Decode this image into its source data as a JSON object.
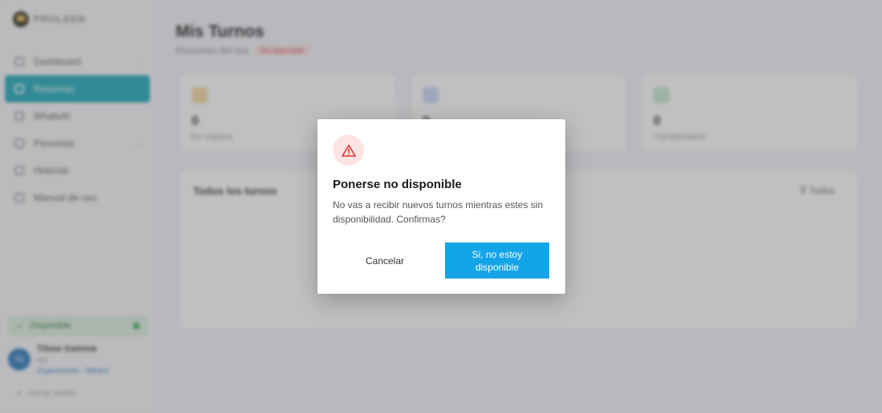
{
  "sidebar": {
    "brand": "PROLEEN",
    "nav": [
      {
        "label": "Dashboard"
      },
      {
        "label": "Reservas"
      },
      {
        "label": "WhatsAI"
      },
      {
        "label": "Personas"
      },
      {
        "label": "Historial"
      },
      {
        "label": "Manual de uso"
      }
    ],
    "availability": "Disponible",
    "user": {
      "initials": "TG",
      "name": "Tilsee Gamma",
      "role": "Vet",
      "tags": "Organización · Médico"
    },
    "logout": "Cerrar sesión"
  },
  "main": {
    "title": "Mis Turnos",
    "subtitle": "Resumen del día",
    "badge": "Sin disponible",
    "stats": [
      {
        "value": "0",
        "label": "En espera",
        "color": "#f5dca0"
      },
      {
        "value": "0",
        "label": "",
        "color": "#c8d8f5"
      },
      {
        "value": "0",
        "label": "Completados",
        "color": "#c5ead0"
      }
    ],
    "panel_title": "Todos los turnos",
    "panel_filter": "Todos"
  },
  "modal": {
    "icon": "warning-triangle-icon",
    "title": "Ponerse no disponible",
    "message": "No vas a recibir nuevos turnos mientras estes sin disponibilidad. Confirmas?",
    "cancel_label": "Cancelar",
    "confirm_label": "Si, no estoy disponible",
    "accent": "#14a5e8",
    "danger": "#d93838"
  }
}
